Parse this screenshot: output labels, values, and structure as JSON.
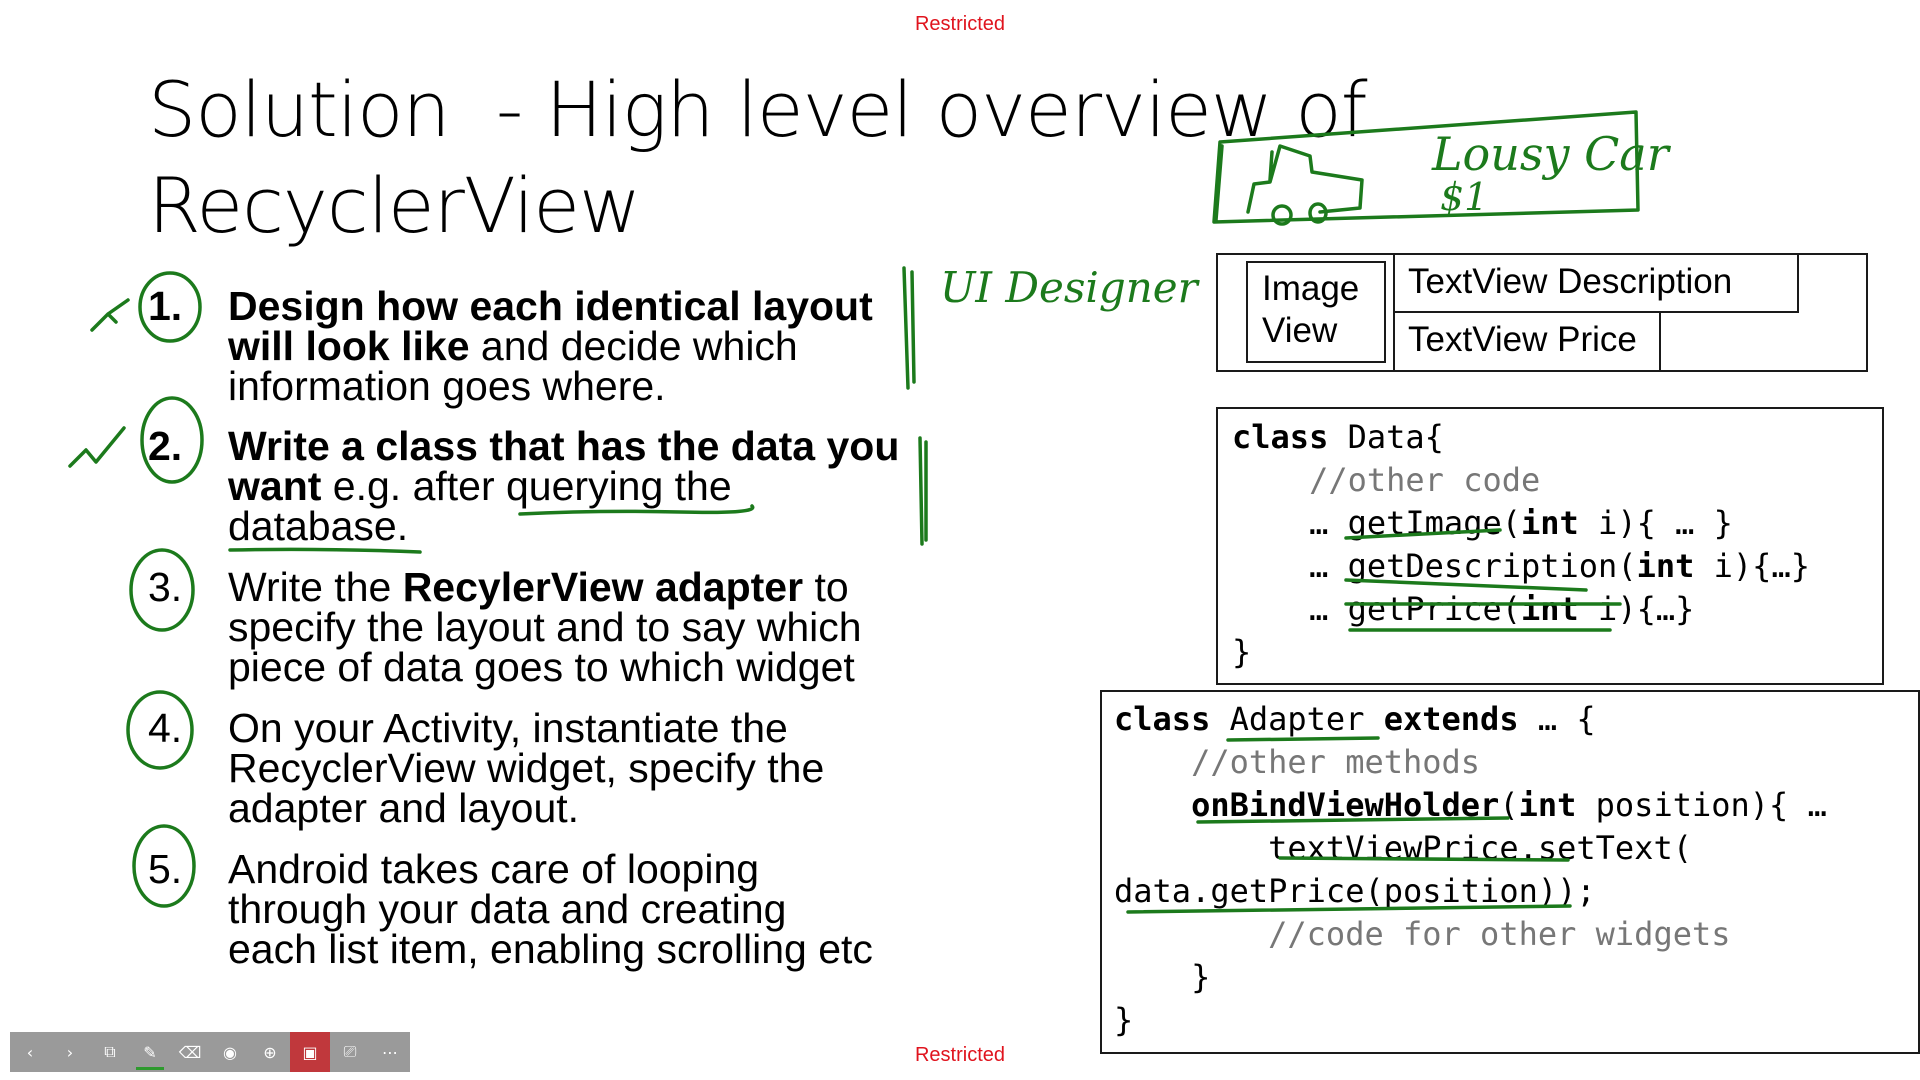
{
  "restricted_label": "Restricted",
  "title": {
    "line1": "Solution  - High level overview of",
    "line2": "RecyclerView"
  },
  "steps": [
    {
      "num": "1.",
      "lines": [
        [
          {
            "t": "Design how each identical layout",
            "b": true
          }
        ],
        [
          {
            "t": "will look like",
            "b": true
          },
          {
            "t": " and decide which",
            "b": false
          }
        ],
        [
          {
            "t": "information goes where.",
            "b": false
          }
        ]
      ]
    },
    {
      "num": "2.",
      "lines": [
        [
          {
            "t": "Write a class that has the data you",
            "b": true
          }
        ],
        [
          {
            "t": "want",
            "b": true
          },
          {
            "t": " e.g. after querying the",
            "b": false
          }
        ],
        [
          {
            "t": "database.",
            "b": false
          }
        ]
      ]
    },
    {
      "num": "3.",
      "lines": [
        [
          {
            "t": "Write the ",
            "b": false
          },
          {
            "t": "RecylerView adapter",
            "b": true
          },
          {
            "t": " to",
            "b": false
          }
        ],
        [
          {
            "t": "specify the layout and to say which",
            "b": false
          }
        ],
        [
          {
            "t": "piece of data goes to which widget",
            "b": false
          }
        ]
      ]
    },
    {
      "num": "4.",
      "lines": [
        [
          {
            "t": "On your Activity, instantiate the",
            "b": false
          }
        ],
        [
          {
            "t": "RecyclerView widget, specify the",
            "b": false
          }
        ],
        [
          {
            "t": "adapter and layout.",
            "b": false
          }
        ]
      ]
    },
    {
      "num": "5.",
      "lines": [
        [
          {
            "t": "Android takes care of looping",
            "b": false
          }
        ],
        [
          {
            "t": "through your data and creating",
            "b": false
          }
        ],
        [
          {
            "t": "each list item, enabling scrolling etc",
            "b": false
          }
        ]
      ]
    }
  ],
  "layout_mock": {
    "image_view_line1": "Image",
    "image_view_line2": "View",
    "textview_description": "TextView Description",
    "textview_price": "TextView Price"
  },
  "data_class_code": [
    [
      {
        "t": "class",
        "k": "kw"
      },
      {
        "t": " Data{",
        "k": ""
      }
    ],
    [
      {
        "t": "    ",
        "k": ""
      },
      {
        "t": "//other code",
        "k": "cm"
      }
    ],
    [
      {
        "t": "    … getImage(",
        "k": ""
      },
      {
        "t": "int",
        "k": "kw"
      },
      {
        "t": " i){ … }",
        "k": ""
      }
    ],
    [
      {
        "t": "    … getDescription(",
        "k": ""
      },
      {
        "t": "int",
        "k": "kw"
      },
      {
        "t": " i){…}",
        "k": ""
      }
    ],
    [
      {
        "t": "    … getPrice(",
        "k": ""
      },
      {
        "t": "int",
        "k": "kw"
      },
      {
        "t": " i){…}",
        "k": ""
      }
    ],
    [
      {
        "t": "}",
        "k": ""
      }
    ]
  ],
  "adapter_class_code": [
    [
      {
        "t": "class",
        "k": "kw"
      },
      {
        "t": " Adapter ",
        "k": ""
      },
      {
        "t": "extends",
        "k": "kw"
      },
      {
        "t": " … {",
        "k": ""
      }
    ],
    [
      {
        "t": "    ",
        "k": ""
      },
      {
        "t": "//other methods",
        "k": "cm"
      }
    ],
    [
      {
        "t": "    ",
        "k": ""
      },
      {
        "t": "onBindViewHolder",
        "k": "kw"
      },
      {
        "t": "(",
        "k": ""
      },
      {
        "t": "int",
        "k": "kw"
      },
      {
        "t": " position){ …",
        "k": ""
      }
    ],
    [
      {
        "t": "        textViewPrice.setText(",
        "k": ""
      }
    ],
    [
      {
        "t": "data.getPrice(position));",
        "k": ""
      }
    ],
    [
      {
        "t": "        ",
        "k": ""
      },
      {
        "t": "//code for other widgets",
        "k": "cm"
      }
    ],
    [
      {
        "t": "    }",
        "k": ""
      }
    ],
    [
      {
        "t": "}",
        "k": ""
      }
    ]
  ],
  "annotations": {
    "ui_designer": "UI Designer",
    "lousy_car": "Lousy Car",
    "price": "$1"
  },
  "toolbar": {
    "buttons": [
      {
        "name": "previous-slide-button",
        "glyph": "‹"
      },
      {
        "name": "next-slide-button",
        "glyph": "›"
      },
      {
        "name": "see-all-slides-button",
        "glyph": "⧉"
      },
      {
        "name": "pen-tool-button",
        "glyph": "✎",
        "underline": true
      },
      {
        "name": "erase-annotations-button",
        "glyph": "⌫"
      },
      {
        "name": "laser-pointer-button",
        "glyph": "◉"
      },
      {
        "name": "zoom-slide-button",
        "glyph": "⊕"
      },
      {
        "name": "camera-toggle-button",
        "glyph": "▣",
        "active": true
      },
      {
        "name": "subtitles-button",
        "glyph": "⎚"
      },
      {
        "name": "more-options-button",
        "glyph": "⋯"
      }
    ]
  }
}
